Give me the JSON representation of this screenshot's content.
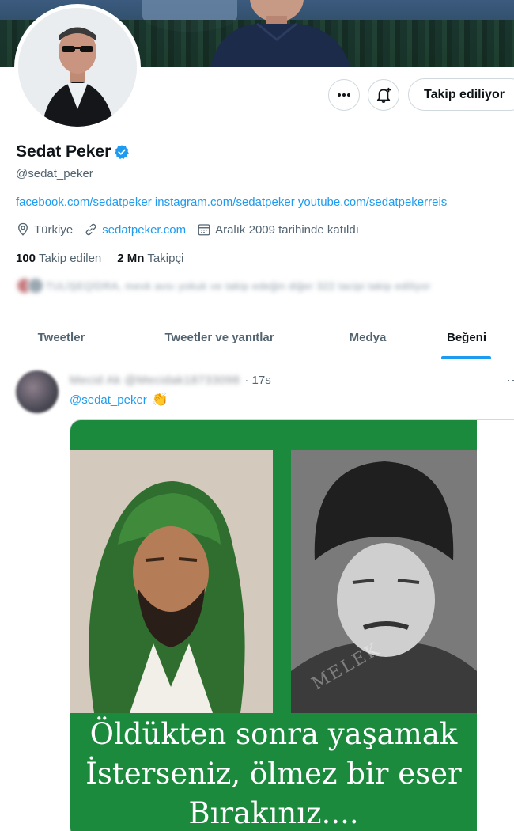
{
  "profile": {
    "name": "Sedat Peker",
    "handle": "@sedat_peker",
    "bio": "facebook.com/sedatpeker instagram.com/sedatpeker youtube.com/sedatpekerreis",
    "location": "Türkiye",
    "website": "sedatpeker.com",
    "joined": "Aralık 2009 tarihinde katıldı",
    "following_count": "100",
    "following_label": "Takip edilen",
    "followers_count": "2 Mn",
    "followers_label": "Takipçi",
    "followed_by_text": "TULİŞEQİDRA, mevk avsı yokuk ve takip edeğin diğer 322 tacipi takip ediliyor"
  },
  "actions": {
    "more_icon": "more-icon",
    "notify_icon": "bell-plus-icon",
    "follow_label": "Takip ediliyor"
  },
  "tabs": [
    {
      "label": "Tweetler"
    },
    {
      "label": "Tweetler ve yanıtlar"
    },
    {
      "label": "Medya"
    },
    {
      "label": "Beğeni"
    }
  ],
  "tweet": {
    "author_blurred": "Mecid Ak @Mecidak18733098",
    "time": "· 17s",
    "mention": "@sedat_peker",
    "emoji": "👏",
    "poster_lines": [
      "Öldükten sonra yaşamak",
      "İsterseniz, ölmez bir eser",
      "Bırakınız...."
    ],
    "watermark": "MELEK"
  },
  "colors": {
    "accent": "#1d9bf0",
    "poster_green": "#1b8a3c",
    "text_secondary": "#536471"
  }
}
